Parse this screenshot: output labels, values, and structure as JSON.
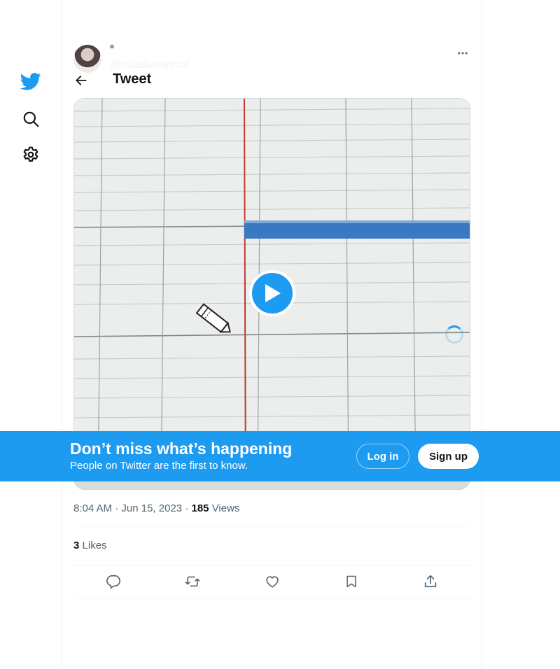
{
  "nav": {
    "icons": [
      "twitter-logo-icon",
      "search-icon",
      "settings-icon"
    ]
  },
  "header": {
    "title": "Tweet"
  },
  "tweet": {
    "display_name": "°",
    "handle": "@sofadalmethod",
    "time": "8:04 AM",
    "date": "Jun 15, 2023",
    "views_count": "185",
    "views_label": "Views",
    "likes_count": "3",
    "likes_label": "Likes"
  },
  "banner": {
    "title": "Don’t miss what’s happening",
    "subtitle": "People on Twitter are the first to know.",
    "login_label": "Log in",
    "signup_label": "Sign up"
  },
  "colors": {
    "brand": "#1d9bf0",
    "text": "#0f1419",
    "secondary": "#536471"
  }
}
